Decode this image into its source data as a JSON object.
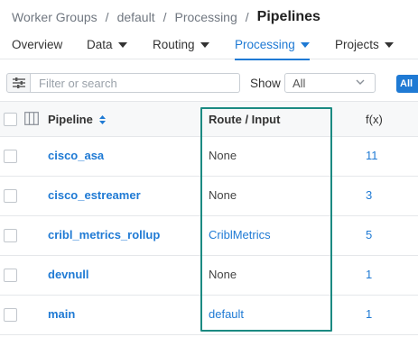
{
  "breadcrumb": {
    "items": [
      "Worker Groups",
      "default",
      "Processing"
    ],
    "separator": "/",
    "current": "Pipelines"
  },
  "nav": {
    "tabs": [
      {
        "label": "Overview",
        "has_dropdown": false,
        "active": false
      },
      {
        "label": "Data",
        "has_dropdown": true,
        "active": false
      },
      {
        "label": "Routing",
        "has_dropdown": true,
        "active": false
      },
      {
        "label": "Processing",
        "has_dropdown": true,
        "active": true
      },
      {
        "label": "Projects",
        "has_dropdown": true,
        "active": false
      }
    ]
  },
  "filter": {
    "icon": "filter-sliders-icon",
    "placeholder": "Filter or search",
    "value": "",
    "show_label": "Show",
    "show_value": "All",
    "all_button": "All"
  },
  "table": {
    "headers": {
      "pipeline": "Pipeline",
      "route_input": "Route / Input",
      "fx": "f(x)"
    },
    "rows": [
      {
        "pipeline": "cisco_asa",
        "route": "None",
        "route_is_link": false,
        "fx": "11"
      },
      {
        "pipeline": "cisco_estreamer",
        "route": "None",
        "route_is_link": false,
        "fx": "3"
      },
      {
        "pipeline": "cribl_metrics_rollup",
        "route": "CriblMetrics",
        "route_is_link": true,
        "fx": "5"
      },
      {
        "pipeline": "devnull",
        "route": "None",
        "route_is_link": false,
        "fx": "1"
      },
      {
        "pipeline": "main",
        "route": "default",
        "route_is_link": true,
        "fx": "1"
      }
    ]
  },
  "colors": {
    "accent": "#1f7ad4",
    "highlight_box": "#1b8a82",
    "breadcrumb_muted": "#707780"
  }
}
